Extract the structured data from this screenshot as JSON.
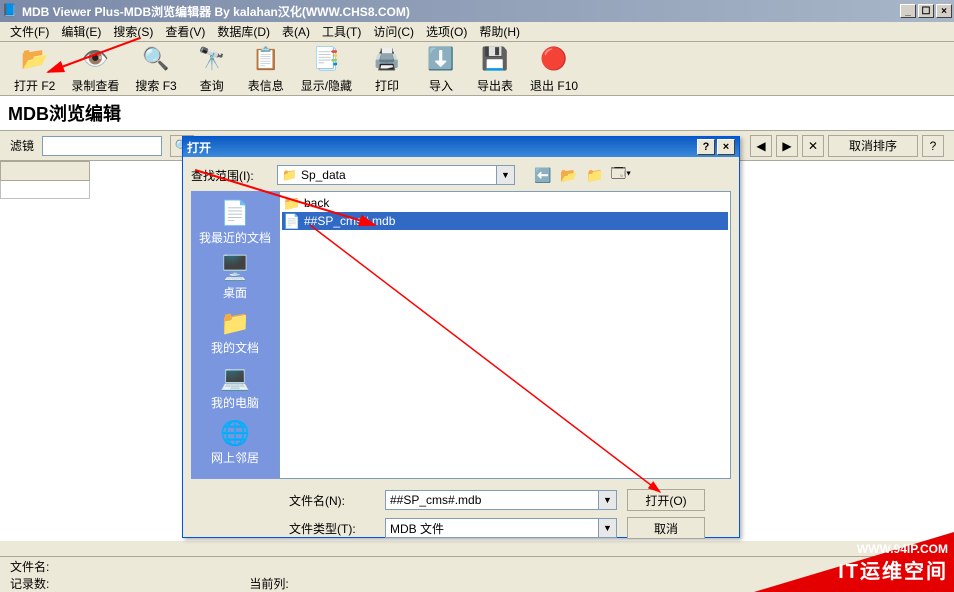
{
  "window": {
    "title": "MDB Viewer Plus-MDB浏览编辑器 By kalahan汉化(WWW.CHS8.COM)"
  },
  "menu": {
    "items": [
      "文件(F)",
      "编辑(E)",
      "搜索(S)",
      "查看(V)",
      "数据库(D)",
      "表(A)",
      "工具(T)",
      "访问(C)",
      "选项(O)",
      "帮助(H)"
    ]
  },
  "toolbar": {
    "open": "打开 F2",
    "record_view": "录制查看",
    "search": "搜索 F3",
    "query": "查询",
    "table_info": "表信息",
    "show_hide": "显示/隐藏",
    "print": "打印",
    "import": "导入",
    "export": "导出表",
    "exit": "退出 F10"
  },
  "subtitle": "MDB浏览编辑",
  "filter": {
    "label": "滤镜",
    "clear_sort": "取消排序",
    "help": "?"
  },
  "dialog": {
    "title": "打开",
    "look_in_label": "查找范围(I):",
    "look_in_value": "Sp_data",
    "places": {
      "recent": "我最近的文档",
      "desktop": "桌面",
      "mydocs": "我的文档",
      "mycomputer": "我的电脑",
      "network": "网上邻居"
    },
    "files": {
      "folder": "back",
      "selected": "##SP_cms#.mdb"
    },
    "filename_label": "文件名(N):",
    "filename_value": "##SP_cms#.mdb",
    "filetype_label": "文件类型(T):",
    "filetype_value": "MDB 文件",
    "open_btn": "打开(O)",
    "cancel_btn": "取消"
  },
  "status": {
    "filename_label": "文件名:",
    "rowcount_label": "记录数:",
    "current_label": "当前列:"
  },
  "watermark": {
    "url": "WWW.94IP.COM",
    "text": "IT运维空间"
  }
}
